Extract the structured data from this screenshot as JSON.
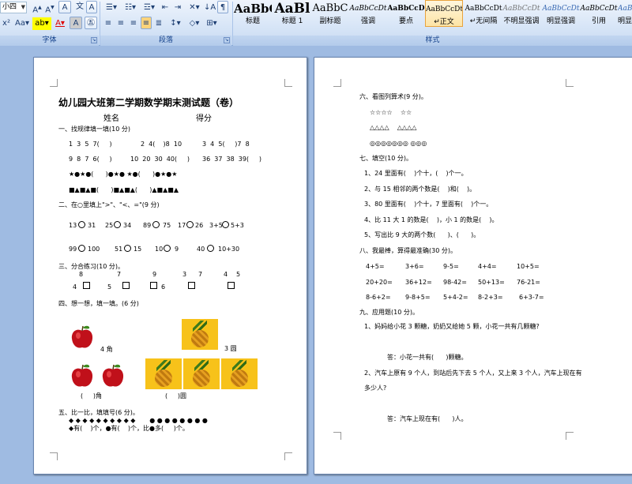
{
  "ribbon": {
    "font_size": "小四",
    "groups": {
      "font": "字体",
      "paragraph": "段落",
      "styles": "样式"
    },
    "styles": [
      {
        "sample": "AaBbC",
        "name": "标题"
      },
      {
        "sample": "AaBl",
        "name": "标题 1"
      },
      {
        "sample": "AaBbC",
        "name": "副标题"
      },
      {
        "sample": "AaBbCcDt",
        "name": "强调"
      },
      {
        "sample": "AaBbCcD",
        "name": "要点"
      },
      {
        "sample": "AaBbCcDt",
        "name": "↵正文"
      },
      {
        "sample": "AaBbCcDt",
        "name": "↵无间隔"
      },
      {
        "sample": "AaBbCcDt",
        "name": "不明显强调"
      },
      {
        "sample": "AaBbCcDt",
        "name": "明显强调"
      },
      {
        "sample": "AaBbCcDt",
        "name": "引用"
      },
      {
        "sample": "AaBbCcDt",
        "name": "明显引用"
      }
    ]
  },
  "left": {
    "title": "幼儿园大班第二学期数学期末测试题（卷）",
    "name_label": "姓名",
    "score_label": "得分",
    "s1": "一、找规律填一填(10 分)",
    "s1_r1a": "1  3  5  7(     )",
    "s1_r1b": "2  4(    )8  10",
    "s1_r1c": "3  4  5(     )7  8",
    "s1_r2a": "9  8  7  6(     )",
    "s1_r2b": "10  20  30  40(     )",
    "s1_r2c": "36  37  38  39(     )",
    "s1_r3": "★●★●(      )●★● ★●(      )●★●★",
    "s1_r4": "■▲■▲■(      )■▲■▲(      )▲■▲■▲",
    "s2": "二、在○里填上\">\"、\"<、=\"(9 分)",
    "s2_r1": [
      "13",
      "31",
      "25",
      "34",
      "89",
      "75",
      "17",
      "26",
      "3+5",
      "5+3"
    ],
    "s2_r2": [
      "99",
      "100",
      "51",
      "15",
      "10",
      "9",
      "40",
      "10+30"
    ],
    "s3": "三、分合练习(10 分)。",
    "s3_top": [
      "8",
      "7",
      "9",
      "3",
      "7",
      "4",
      "5"
    ],
    "s3_bottom": [
      "4",
      "5",
      "6"
    ],
    "s4": "四、想一想，填一填。(6 分)",
    "s4_apples1": "4 角",
    "s4_pine1": "3 圆",
    "s4_apples2": "(     )角",
    "s4_pine2": "(     )圆",
    "s5": "五、比一比，填填号(6 分)。",
    "s5_r1": "◆ ◆ ◆ ◆ ◆ ◆ ◆ ◆ ◆ ◆       ● ● ● ● ● ● ● ●",
    "s5_r2": "◆有(    )个，●有(    )个，比●多(     )个。"
  },
  "right": {
    "s6": "六、看图列算术(9 分)。",
    "s6_r1": "☆☆☆☆    ☆☆",
    "s6_r2": "△△△△    △△△△",
    "s6_r3": "◎◎◎◎◎◎◎ ◎◎◎",
    "s7": "七、填空(10 分)。",
    "s7_items": [
      "1、24 里面有(    )个十，(    )个一。",
      "2、与 15 相邻的两个数是(    )和(    )。",
      "3、80 里面有(    )个十，7 里面有(    )个一。",
      "4、比 11 大 1 的数是(    )，小 1 的数是(    )。",
      "5、写出比 9 大的两个数(      )、(      )。"
    ],
    "s8": "八、我最棒，算得最准确(30 分)。",
    "s8_rows": [
      [
        "4+5=",
        "3+6=",
        "9-5=",
        "4+4=",
        "10+5="
      ],
      [
        "20+20=",
        "36+12=",
        "98-42=",
        "50+13=",
        "76-21="
      ],
      [
        "8-6+2=",
        "9-8+5=",
        "5+4-2=",
        "8-2+3=",
        "6+3-7="
      ]
    ],
    "s9": "九、应用题(10 分)。",
    "s9_q1": "1、妈妈给小花 3 颗糖，奶奶又给她 5 颗，小花一共有几颗糖?",
    "s9_a1": "答：小花一共有(      )颗糖。",
    "s9_q2a": "2、汽车上原有 9 个人，到站后先下去 5 个人，又上来 3 个人，汽车上现在有",
    "s9_q2b": "多少人?",
    "s9_a2": "答：汽车上现在有(      )人。"
  }
}
